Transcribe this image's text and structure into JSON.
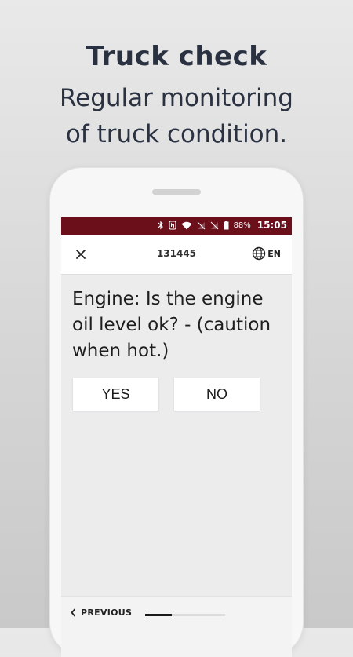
{
  "promo": {
    "title": "Truck check",
    "subtitle_line1": "Regular monitoring",
    "subtitle_line2": "of truck condition."
  },
  "status_bar": {
    "battery": "88%",
    "time": "15:05",
    "icons": [
      "bluetooth-icon",
      "nfc-icon",
      "wifi-icon",
      "signal-off-icon",
      "signal-off-icon",
      "battery-icon"
    ]
  },
  "header": {
    "id": "131445",
    "language": "EN",
    "icons": [
      "close-icon",
      "globe-icon"
    ]
  },
  "question": {
    "line1": "Engine: Is the engine",
    "line2": "oil level ok? - (caution",
    "line3": "when hot.)"
  },
  "answers": {
    "yes": "YES",
    "no": "NO"
  },
  "navigation": {
    "previous": "PREVIOUS",
    "progress": 0.33
  },
  "colors": {
    "status_bar": "#6b0f1a",
    "text_dark": "#2a3140"
  }
}
